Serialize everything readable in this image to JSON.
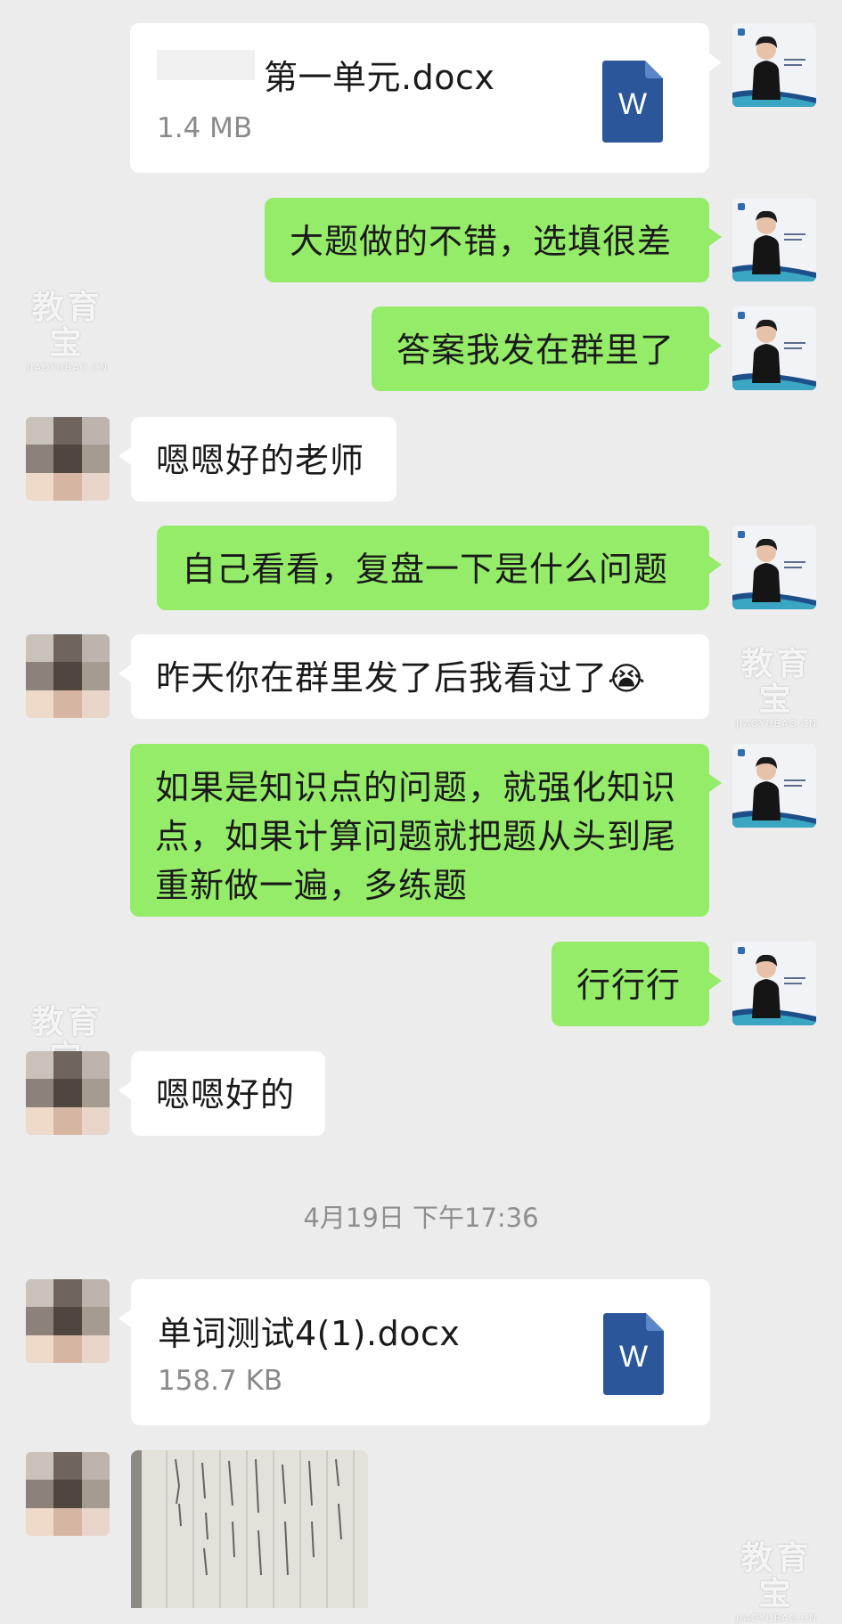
{
  "messages": {
    "file1": {
      "name": "第一单元.docx",
      "size": "1.4 MB",
      "icon": "word-file-icon"
    },
    "m1": "大题做的不错，选填很差",
    "m2": "答案我发在群里了",
    "m3": "嗯嗯好的老师",
    "m4": "自己看看，复盘一下是什么问题",
    "m5": "昨天你在群里发了后我看过了",
    "m5_emoji": "😭",
    "m6": "如果是知识点的问题，就强化知识点，如果计算问题就把题从头到尾重新做一遍，多练题",
    "m7": "行行行",
    "m8": "嗯嗯好的",
    "timestamp": "4月19日 下午17:36",
    "file2": {
      "name": "单词测试4(1).docx",
      "size": "158.7 KB",
      "icon": "word-file-icon"
    },
    "word_icon_letter": "W"
  },
  "watermark": {
    "main": "教育宝",
    "sub": "JIAOYUBAO.CN"
  },
  "colors": {
    "sent_bubble": "#95ec69",
    "received_bubble": "#ffffff",
    "background": "#ececec",
    "word_blue": "#2b579a"
  }
}
